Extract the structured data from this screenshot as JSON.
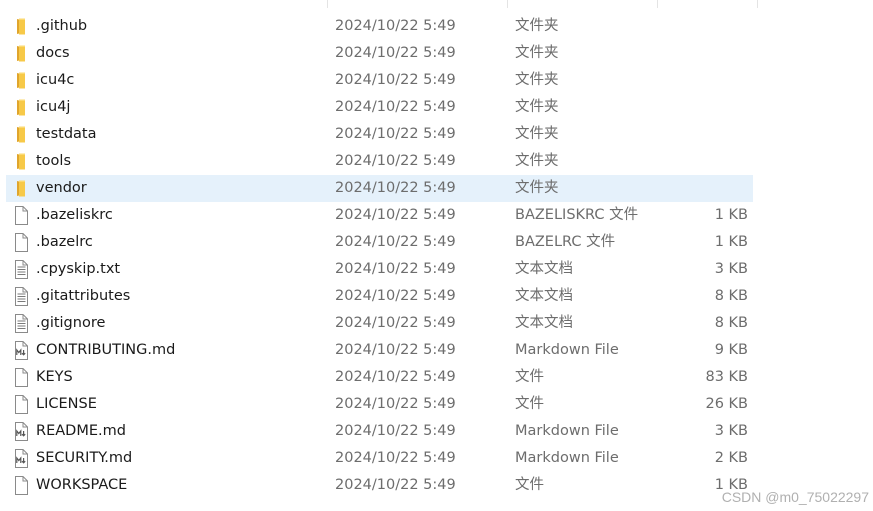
{
  "colors": {
    "selected_row": "#e5f1fb",
    "folder": "#f7c948",
    "secondary_text": "#6d6d6d"
  },
  "files": [
    {
      "name": ".github",
      "date": "2024/10/22 5:49",
      "type": "文件夹",
      "size": "",
      "icon": "folder-icon"
    },
    {
      "name": "docs",
      "date": "2024/10/22 5:49",
      "type": "文件夹",
      "size": "",
      "icon": "folder-icon"
    },
    {
      "name": "icu4c",
      "date": "2024/10/22 5:49",
      "type": "文件夹",
      "size": "",
      "icon": "folder-icon"
    },
    {
      "name": "icu4j",
      "date": "2024/10/22 5:49",
      "type": "文件夹",
      "size": "",
      "icon": "folder-icon"
    },
    {
      "name": "testdata",
      "date": "2024/10/22 5:49",
      "type": "文件夹",
      "size": "",
      "icon": "folder-icon"
    },
    {
      "name": "tools",
      "date": "2024/10/22 5:49",
      "type": "文件夹",
      "size": "",
      "icon": "folder-icon"
    },
    {
      "name": "vendor",
      "date": "2024/10/22 5:49",
      "type": "文件夹",
      "size": "",
      "icon": "folder-icon",
      "selected": true
    },
    {
      "name": ".bazeliskrc",
      "date": "2024/10/22 5:49",
      "type": "BAZELISKRC 文件",
      "size": "1 KB",
      "icon": "blank-file-icon"
    },
    {
      "name": ".bazelrc",
      "date": "2024/10/22 5:49",
      "type": "BAZELRC 文件",
      "size": "1 KB",
      "icon": "blank-file-icon"
    },
    {
      "name": ".cpyskip.txt",
      "date": "2024/10/22 5:49",
      "type": "文本文档",
      "size": "3 KB",
      "icon": "text-file-icon"
    },
    {
      "name": ".gitattributes",
      "date": "2024/10/22 5:49",
      "type": "文本文档",
      "size": "8 KB",
      "icon": "text-file-icon"
    },
    {
      "name": ".gitignore",
      "date": "2024/10/22 5:49",
      "type": "文本文档",
      "size": "8 KB",
      "icon": "text-file-icon"
    },
    {
      "name": "CONTRIBUTING.md",
      "date": "2024/10/22 5:49",
      "type": "Markdown File",
      "size": "9 KB",
      "icon": "markdown-file-icon"
    },
    {
      "name": "KEYS",
      "date": "2024/10/22 5:49",
      "type": "文件",
      "size": "83 KB",
      "icon": "blank-file-icon"
    },
    {
      "name": "LICENSE",
      "date": "2024/10/22 5:49",
      "type": "文件",
      "size": "26 KB",
      "icon": "blank-file-icon"
    },
    {
      "name": "README.md",
      "date": "2024/10/22 5:49",
      "type": "Markdown File",
      "size": "3 KB",
      "icon": "markdown-file-icon"
    },
    {
      "name": "SECURITY.md",
      "date": "2024/10/22 5:49",
      "type": "Markdown File",
      "size": "2 KB",
      "icon": "markdown-file-icon"
    },
    {
      "name": "WORKSPACE",
      "date": "2024/10/22 5:49",
      "type": "文件",
      "size": "1 KB",
      "icon": "blank-file-icon"
    }
  ],
  "watermark": "CSDN @m0_75022297"
}
